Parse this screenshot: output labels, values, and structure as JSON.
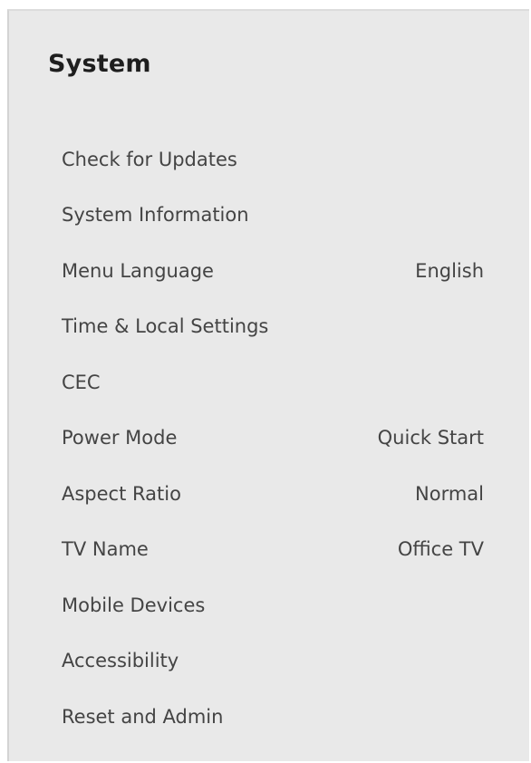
{
  "panel": {
    "title": "System",
    "background": "#e9e9e9"
  },
  "menu": {
    "items": [
      {
        "label": "Check for Updates",
        "value": ""
      },
      {
        "label": "System Information",
        "value": ""
      },
      {
        "label": "Menu Language",
        "value": "English"
      },
      {
        "label": "Time & Local Settings",
        "value": ""
      },
      {
        "label": "CEC",
        "value": ""
      },
      {
        "label": "Power Mode",
        "value": "Quick Start"
      },
      {
        "label": "Aspect Ratio",
        "value": "Normal"
      },
      {
        "label": "TV Name",
        "value": "Office TV"
      },
      {
        "label": "Mobile Devices",
        "value": ""
      },
      {
        "label": "Accessibility",
        "value": ""
      },
      {
        "label": "Reset and Admin",
        "value": ""
      }
    ]
  }
}
